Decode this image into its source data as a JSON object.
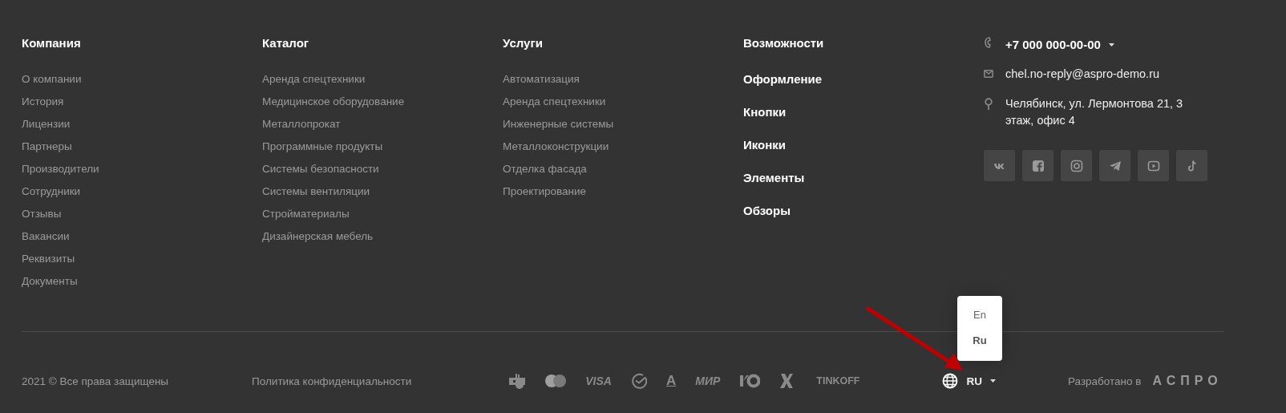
{
  "columns": [
    {
      "title": "Компания",
      "kind": "links",
      "items": [
        "О компании",
        "История",
        "Лицензии",
        "Партнеры",
        "Производители",
        "Сотрудники",
        "Отзывы",
        "Вакансии",
        "Реквизиты",
        "Документы"
      ]
    },
    {
      "title": "Каталог",
      "kind": "links",
      "items": [
        "Аренда спецтехники",
        "Медицинское оборудование",
        "Металлопрокат",
        "Программные продукты",
        "Системы безопасности",
        "Системы вентиляции",
        "Стройматериалы",
        "Дизайнерская мебель"
      ]
    },
    {
      "title": "Услуги",
      "kind": "links",
      "items": [
        "Автоматизация",
        "Аренда спецтехники",
        "Инженерные системы",
        "Металлоконструкции",
        "Отделка фасада",
        "Проектирование"
      ]
    },
    {
      "title": "Возможности",
      "kind": "features",
      "items": [
        "Оформление",
        "Кнопки",
        "Иконки",
        "Элементы",
        "Обзоры"
      ]
    }
  ],
  "contacts": {
    "phone": "+7 000 000-00-00",
    "email": "chel.no-reply@aspro-demo.ru",
    "address": "Челябинск, ул. Лермонтова 21, 3 этаж, офис 4"
  },
  "bottom": {
    "copyright": "2021 © Все права защищены",
    "privacy": "Политика конфиденциальности",
    "payments": [
      {
        "kind": "cashbox"
      },
      {
        "kind": "mastercard"
      },
      {
        "kind": "text",
        "label": "VISA"
      },
      {
        "kind": "check"
      },
      {
        "kind": "alfa",
        "label": "А"
      },
      {
        "kind": "text",
        "label": "МИР"
      },
      {
        "kind": "yoo"
      },
      {
        "kind": "x"
      },
      {
        "kind": "text",
        "label": "TINKOFF"
      }
    ],
    "language": {
      "current": "RU",
      "options": [
        {
          "label": "En",
          "selected": false
        },
        {
          "label": "Ru",
          "selected": true
        }
      ]
    },
    "developer": {
      "label": "Разработано в",
      "brand": "АСПРО"
    }
  }
}
